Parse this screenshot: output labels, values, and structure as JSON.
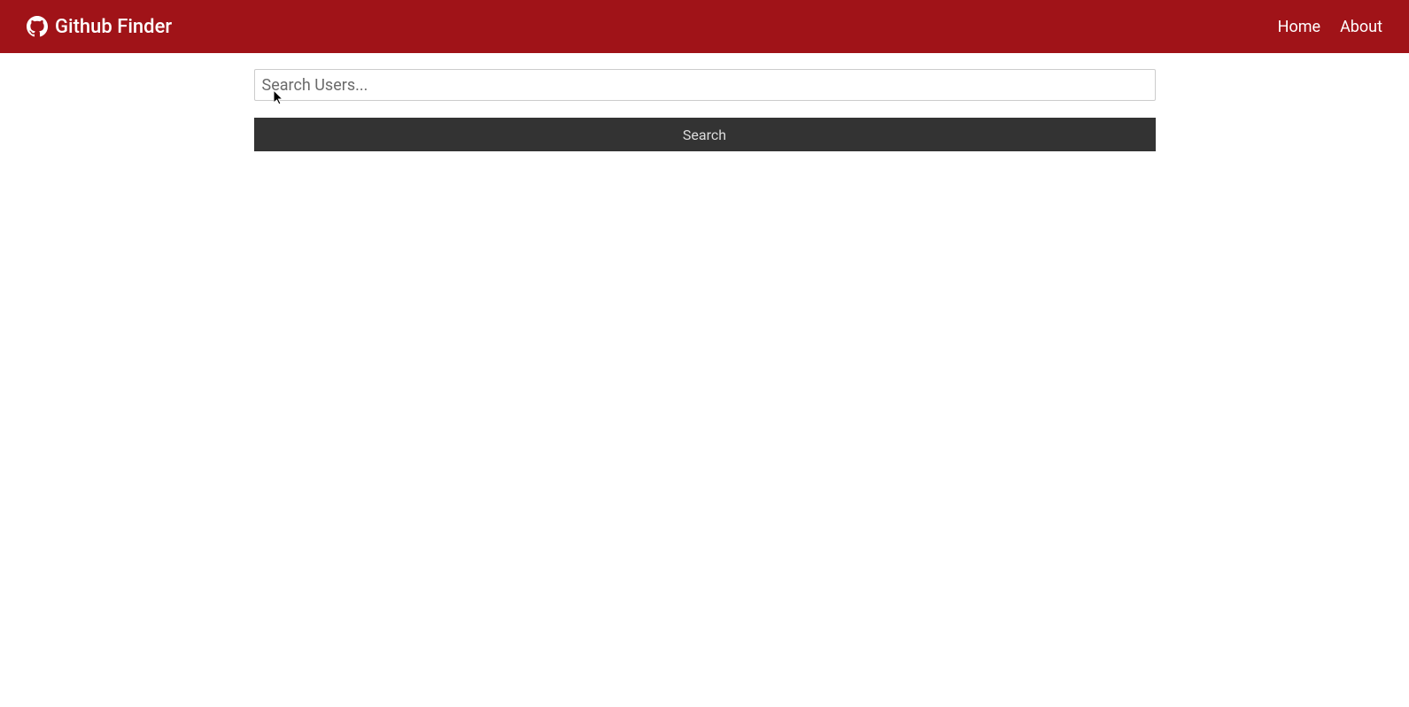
{
  "navbar": {
    "brand_title": "Github Finder",
    "links": [
      {
        "label": "Home"
      },
      {
        "label": "About"
      }
    ]
  },
  "search": {
    "placeholder": "Search Users...",
    "value": "",
    "button_label": "Search"
  },
  "colors": {
    "navbar_bg": "#a01318",
    "button_bg": "#333333"
  }
}
